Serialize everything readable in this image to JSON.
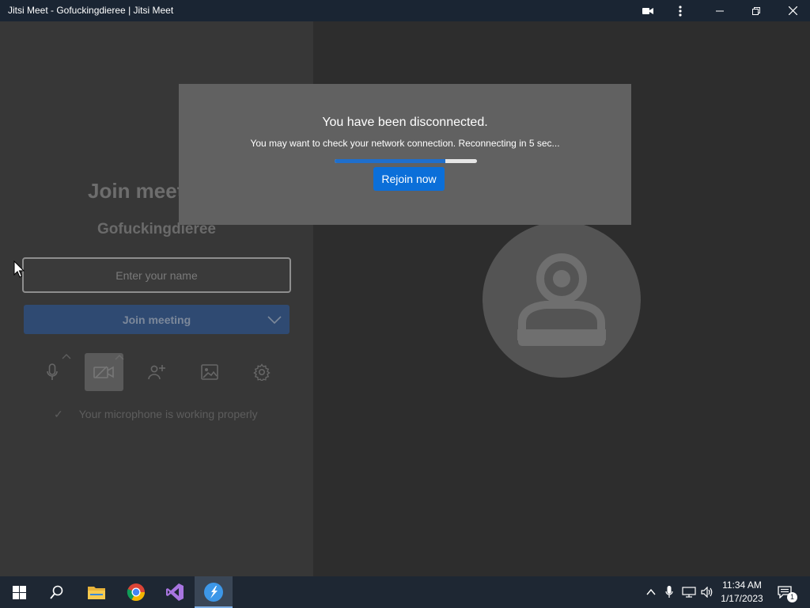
{
  "window": {
    "title": "Jitsi Meet - Gofuckingdieree | Jitsi Meet"
  },
  "prejoin": {
    "heading": "Join meet",
    "room_name": "Gofuckingdieree",
    "name_placeholder": "Enter your name",
    "join_label": "Join meeting",
    "mic_status": "Your microphone is working properly"
  },
  "dialog": {
    "heading": "You have been disconnected.",
    "message": "You may want to check your network connection. Reconnecting in 5 sec...",
    "progress_fraction": 0.78,
    "rejoin_label": "Rejoin now"
  },
  "colors": {
    "accent": "#0b6fd9",
    "progress": "#1f6fcc"
  },
  "taskbar": {
    "time": "11:34 AM",
    "date": "1/17/2023",
    "notification_count": "1"
  }
}
